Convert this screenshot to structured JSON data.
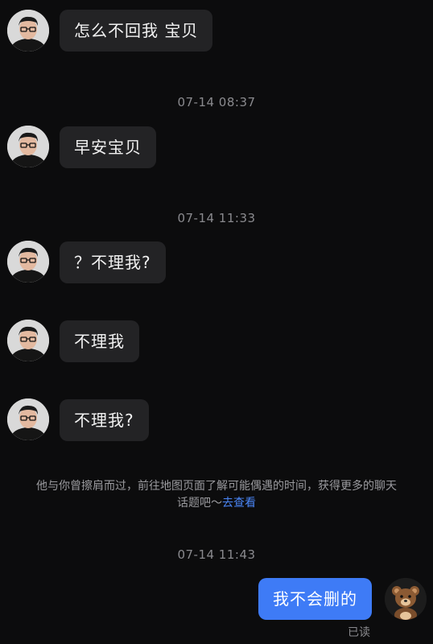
{
  "messages": [
    {
      "text": "怎么不回我 宝贝"
    },
    {
      "text": "早安宝贝"
    },
    {
      "text": "？不理我?"
    },
    {
      "text": "不理我"
    },
    {
      "text": "不理我?"
    }
  ],
  "timestamps": [
    "07-14 08:37",
    "07-14 11:33",
    "07-14 11:43"
  ],
  "notice": {
    "text": "他与你曾擦肩而过，前往地图页面了解可能偶遇的时间，获得更多的聊天话题吧～",
    "link": "去查看"
  },
  "my_message": {
    "text": "我不会删的"
  },
  "read_status": "已读",
  "colors": {
    "background": "#0c0c0d",
    "incoming_bubble": "#232325",
    "outgoing_bubble": "#3e7bf6",
    "link": "#4a86f7",
    "meta_text": "#8a8a8e"
  },
  "icons": {
    "contact_avatar": "man-with-glasses-avatar",
    "my_avatar": "teddy-bear-avatar"
  }
}
